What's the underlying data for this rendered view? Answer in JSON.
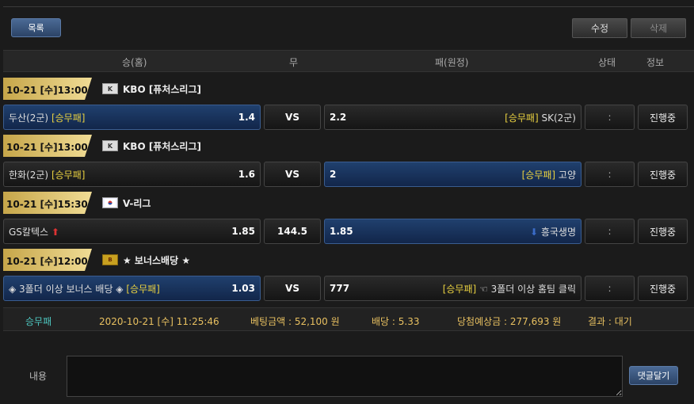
{
  "toolbar": {
    "list_label": "목록",
    "edit_label": "수정",
    "delete_label": "삭제"
  },
  "header": {
    "home": "승(홈)",
    "draw": "무",
    "away": "패(원정)",
    "status": "상태",
    "info": "정보"
  },
  "matches": [
    {
      "date": "10-21 [수]13:00",
      "league_icon": "kbo-logo-icon",
      "league": "KBO [퓨처스리그]",
      "home": "두산(2군)",
      "home_tag": "[승무패]",
      "home_odd": "1.4",
      "draw": "VS",
      "away_odd": "2.2",
      "away_tag": "[승무패]",
      "away": "SK(2군)",
      "status": ":",
      "info": "진행중",
      "selected": "home"
    },
    {
      "date": "10-21 [수]13:00",
      "league_icon": "kbo-logo-icon",
      "league": "KBO [퓨처스리그]",
      "home": "한화(2군)",
      "home_tag": "[승무패]",
      "home_odd": "1.6",
      "draw": "VS",
      "away_odd": "2",
      "away_tag": "[승무패]",
      "away": "고양",
      "status": ":",
      "info": "진행중",
      "selected": "away"
    },
    {
      "date": "10-21 [수]15:30",
      "league_icon": "korea-flag-icon",
      "league": "V-리그",
      "home": "GS칼텍스",
      "home_arrow": "⬆",
      "home_odd": "1.85",
      "draw": "144.5",
      "away_odd": "1.85",
      "away_arrow": "⬇",
      "away": "흥국생명",
      "status": ":",
      "info": "진행중",
      "selected": "away"
    },
    {
      "date": "10-21 [수]12:00",
      "league_icon": "bonus-icon",
      "league": "★ 보너스배당 ★",
      "home": "◈ 3폴더 이상 보너스 배당 ◈",
      "home_tag": "[승무패]",
      "home_odd": "1.03",
      "draw": "VS",
      "away_odd": "777",
      "away_tag": "[승무패]",
      "away": "☜ 3폴더 이상 홈팀 클릭",
      "status": ":",
      "info": "진행중",
      "selected": "home"
    }
  ],
  "summary": {
    "type": "승무패",
    "datetime": "2020-10-21 [수] 11:25:46",
    "bet": "베팅금액 : 52,100 원",
    "odds": "배당 : 5.33",
    "payout": "당첨예상금 : 277,693 원",
    "result": "결과 : 대기"
  },
  "comment": {
    "label": "내용",
    "button": "댓글달기"
  },
  "colors": {
    "selected": "#1c3a66",
    "accent_gold": "#e8c060",
    "tag_yellow": "#e8d040",
    "cyan": "#4ec7c0"
  }
}
